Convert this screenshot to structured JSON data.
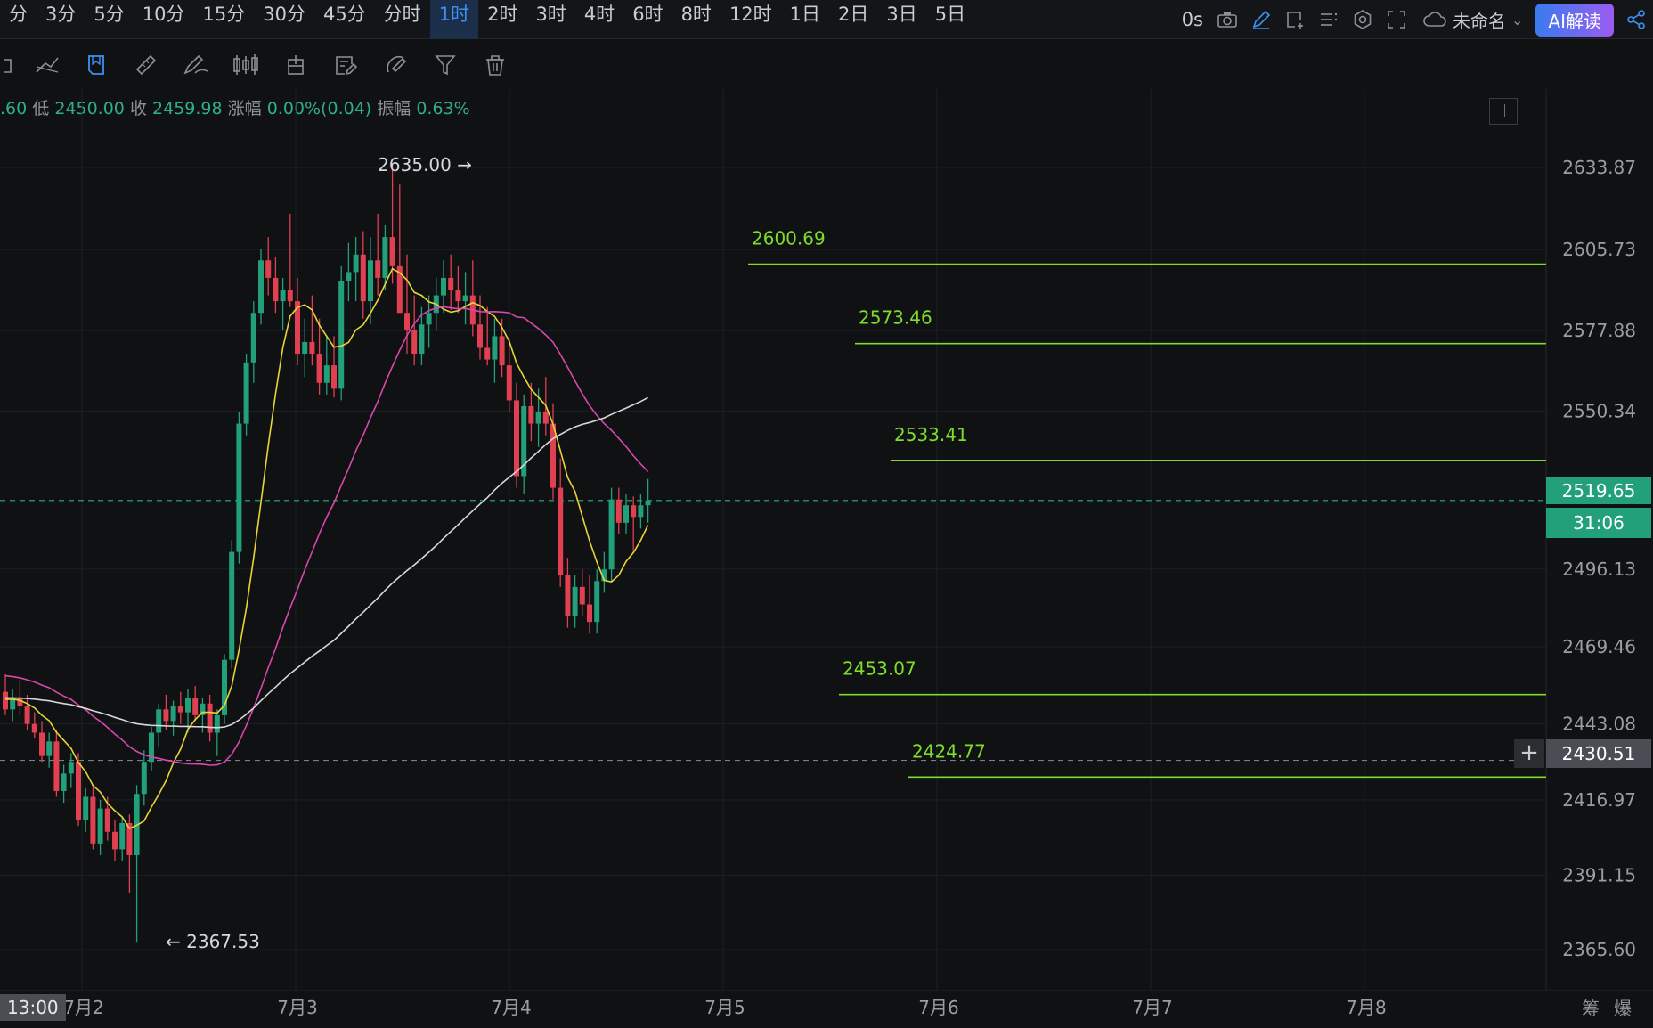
{
  "toolbar": {
    "timeframes": [
      "分",
      "3分",
      "5分",
      "10分",
      "15分",
      "30分",
      "45分",
      "分时",
      "1时",
      "2时",
      "3时",
      "4时",
      "6时",
      "8时",
      "12时",
      "1日",
      "2日",
      "3日",
      "5日"
    ],
    "active_timeframe": "1时",
    "seconds_label": "0s",
    "layout_name": "未命名",
    "ai_label": "AI解读"
  },
  "drawing_tools": [
    "undo-icon",
    "trend-tools-icon",
    "bookmark-icon",
    "ruler-icon",
    "pen-icon",
    "candle-pattern-icon",
    "position-icon",
    "note-icon",
    "brush-icon",
    "filter-icon",
    "trash-icon"
  ],
  "info": {
    "open_partial": ".60",
    "low_label": "低",
    "low_value": "2450.00",
    "close_label": "收",
    "close_value": "2459.98",
    "change_label": "涨幅",
    "change_value": "0.00%(0.04)",
    "amp_label": "振幅",
    "amp_value": "0.63%"
  },
  "price_tags": {
    "current": "2519.65",
    "countdown": "31:06",
    "crosshair_price": "2430.51",
    "crosshair_date": "13:00"
  },
  "bottom_right": "筹爆",
  "colors": {
    "up": "#22a07a",
    "down": "#e04050",
    "ma_yellow": "#e8d437",
    "ma_magenta": "#d946b0",
    "ma_white": "#d8d8d8",
    "level": "#7fdc2a"
  },
  "chart_data": {
    "type": "candlestick",
    "y_axis_ticks": [
      2633.87,
      2605.73,
      2577.88,
      2550.34,
      2496.13,
      2469.46,
      2443.08,
      2416.97,
      2391.15,
      2365.6
    ],
    "y_axis_labels": [
      "2633.87",
      "2605.73",
      "2577.88",
      "2550.34",
      "2496.13",
      "2469.46",
      "2443.08",
      "2416.97",
      "2391.15",
      "2365.60"
    ],
    "x_axis_labels": [
      "7月2",
      "7月3",
      "7月4",
      "7月5",
      "7月6",
      "7月7",
      "7月8"
    ],
    "high_marker": "2635.00",
    "low_marker": "2367.53",
    "horizontal_levels": [
      {
        "label": "2600.69",
        "value": 2600.69
      },
      {
        "label": "2573.46",
        "value": 2573.46
      },
      {
        "label": "2533.41",
        "value": 2533.41
      },
      {
        "label": "2453.07",
        "value": 2453.07
      },
      {
        "label": "2424.77",
        "value": 2424.77
      }
    ],
    "current_price": 2519.65,
    "crosshair_price": 2430.51,
    "candles": [
      [
        2454,
        2460,
        2446,
        2448
      ],
      [
        2448,
        2455,
        2444,
        2452
      ],
      [
        2452,
        2458,
        2446,
        2449
      ],
      [
        2449,
        2453,
        2441,
        2443
      ],
      [
        2443,
        2447,
        2438,
        2440
      ],
      [
        2440,
        2444,
        2430,
        2432
      ],
      [
        2432,
        2440,
        2428,
        2437
      ],
      [
        2437,
        2441,
        2418,
        2420
      ],
      [
        2420,
        2429,
        2416,
        2426
      ],
      [
        2426,
        2433,
        2421,
        2430
      ],
      [
        2430,
        2433,
        2408,
        2410
      ],
      [
        2410,
        2421,
        2406,
        2418
      ],
      [
        2418,
        2422,
        2400,
        2402
      ],
      [
        2402,
        2417,
        2398,
        2414
      ],
      [
        2414,
        2418,
        2403,
        2406
      ],
      [
        2406,
        2410,
        2396,
        2400
      ],
      [
        2400,
        2411,
        2396,
        2409
      ],
      [
        2409,
        2412,
        2385,
        2398
      ],
      [
        2398,
        2422,
        2368,
        2419
      ],
      [
        2419,
        2434,
        2415,
        2430
      ],
      [
        2430,
        2442,
        2427,
        2440
      ],
      [
        2440,
        2450,
        2435,
        2448
      ],
      [
        2448,
        2453,
        2441,
        2444
      ],
      [
        2444,
        2451,
        2439,
        2449
      ],
      [
        2449,
        2454,
        2443,
        2447
      ],
      [
        2447,
        2455,
        2440,
        2452
      ],
      [
        2452,
        2456,
        2444,
        2446
      ],
      [
        2446,
        2452,
        2440,
        2450
      ],
      [
        2450,
        2453,
        2437,
        2440
      ],
      [
        2440,
        2448,
        2432,
        2446
      ],
      [
        2446,
        2467,
        2443,
        2465
      ],
      [
        2465,
        2506,
        2462,
        2502
      ],
      [
        2502,
        2550,
        2498,
        2546
      ],
      [
        2546,
        2570,
        2542,
        2567
      ],
      [
        2567,
        2588,
        2560,
        2584
      ],
      [
        2584,
        2606,
        2580,
        2602
      ],
      [
        2602,
        2610,
        2590,
        2596
      ],
      [
        2596,
        2603,
        2584,
        2588
      ],
      [
        2588,
        2596,
        2578,
        2592
      ],
      [
        2592,
        2618,
        2586,
        2588
      ],
      [
        2588,
        2596,
        2566,
        2570
      ],
      [
        2570,
        2582,
        2562,
        2574
      ],
      [
        2574,
        2590,
        2566,
        2570
      ],
      [
        2570,
        2582,
        2556,
        2560
      ],
      [
        2560,
        2576,
        2556,
        2566
      ],
      [
        2566,
        2576,
        2555,
        2558
      ],
      [
        2558,
        2600,
        2554,
        2595
      ],
      [
        2595,
        2608,
        2588,
        2598
      ],
      [
        2598,
        2610,
        2588,
        2604
      ],
      [
        2604,
        2612,
        2582,
        2588
      ],
      [
        2588,
        2610,
        2580,
        2602
      ],
      [
        2602,
        2618,
        2590,
        2596
      ],
      [
        2596,
        2614,
        2592,
        2610
      ],
      [
        2610,
        2635,
        2594,
        2600
      ],
      [
        2600,
        2628,
        2584,
        2584
      ],
      [
        2584,
        2604,
        2570,
        2578
      ],
      [
        2578,
        2590,
        2566,
        2570
      ],
      [
        2570,
        2586,
        2566,
        2580
      ],
      [
        2580,
        2590,
        2572,
        2584
      ],
      [
        2584,
        2596,
        2578,
        2590
      ],
      [
        2590,
        2602,
        2584,
        2596
      ],
      [
        2596,
        2604,
        2585,
        2592
      ],
      [
        2592,
        2600,
        2584,
        2588
      ],
      [
        2588,
        2598,
        2580,
        2590
      ],
      [
        2590,
        2602,
        2576,
        2580
      ],
      [
        2580,
        2590,
        2568,
        2572
      ],
      [
        2572,
        2586,
        2566,
        2568
      ],
      [
        2568,
        2582,
        2560,
        2576
      ],
      [
        2576,
        2582,
        2562,
        2566
      ],
      [
        2566,
        2575,
        2550,
        2554
      ],
      [
        2554,
        2560,
        2524,
        2528
      ],
      [
        2528,
        2556,
        2522,
        2552
      ],
      [
        2552,
        2560,
        2540,
        2546
      ],
      [
        2546,
        2558,
        2538,
        2550
      ],
      [
        2550,
        2562,
        2542,
        2546
      ],
      [
        2546,
        2553,
        2520,
        2524
      ],
      [
        2524,
        2534,
        2490,
        2494
      ],
      [
        2494,
        2500,
        2476,
        2480
      ],
      [
        2480,
        2494,
        2476,
        2490
      ],
      [
        2490,
        2496,
        2480,
        2484
      ],
      [
        2484,
        2494,
        2474,
        2478
      ],
      [
        2478,
        2496,
        2474,
        2492
      ],
      [
        2492,
        2502,
        2488,
        2496
      ],
      [
        2496,
        2524,
        2492,
        2520
      ],
      [
        2520,
        2524,
        2508,
        2512
      ],
      [
        2512,
        2522,
        2508,
        2518
      ],
      [
        2518,
        2521,
        2502,
        2514
      ],
      [
        2514,
        2522,
        2510,
        2518
      ],
      [
        2518,
        2527,
        2512,
        2519.65
      ]
    ]
  }
}
